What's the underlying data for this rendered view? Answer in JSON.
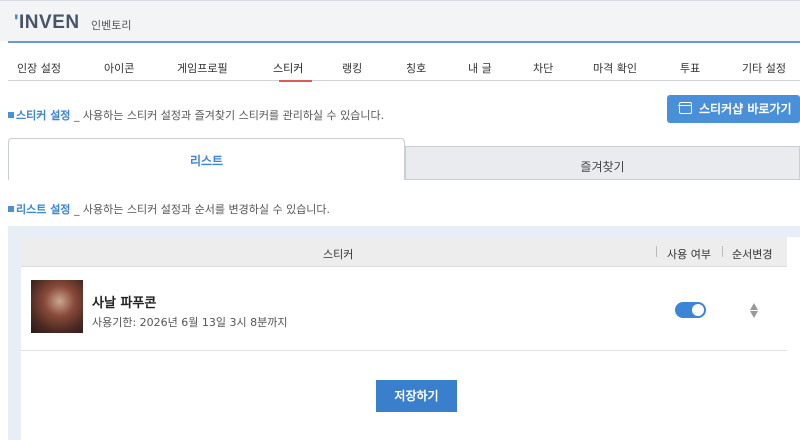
{
  "header": {
    "logo": "INVEN",
    "logo_tick": "'",
    "subtitle": "인벤토리"
  },
  "nav": {
    "items": [
      "인장 설정",
      "아이콘",
      "게임프로필",
      "스티커",
      "랭킹",
      "칭호",
      "내 글",
      "차단",
      "마격 확인",
      "투표",
      "기타 설정"
    ],
    "active_index": 3
  },
  "sticker_section": {
    "label": "스티커 설정",
    "desc": "_ 사용하는 스티커 설정과 즐겨찾기 스티커를 관리하실 수 있습니다."
  },
  "shop_button": {
    "label": "스티커샵 바로가기",
    "icon": "shop-icon"
  },
  "tabs": [
    {
      "label": "리스트",
      "active": true
    },
    {
      "label": "즐겨찾기",
      "active": false
    }
  ],
  "list_section": {
    "label": "리스트 설정",
    "desc": "_ 사용하는 스티커 설정과 순서를 변경하실 수 있습니다."
  },
  "table": {
    "headers": {
      "sticker": "스티커",
      "use": "사용 여부",
      "order": "순서변경"
    },
    "rows": [
      {
        "name": "사날 파푸콘",
        "expiry": "사용기한: 2026년 6월 13일 3시 8분까지",
        "enabled": true
      }
    ]
  },
  "save_button": {
    "label": "저장하기"
  },
  "colors": {
    "accent": "#3a85d6",
    "nav_border": "#6b98d6",
    "active_underline": "#e05a5a",
    "panel_bg": "#e8eef5"
  }
}
